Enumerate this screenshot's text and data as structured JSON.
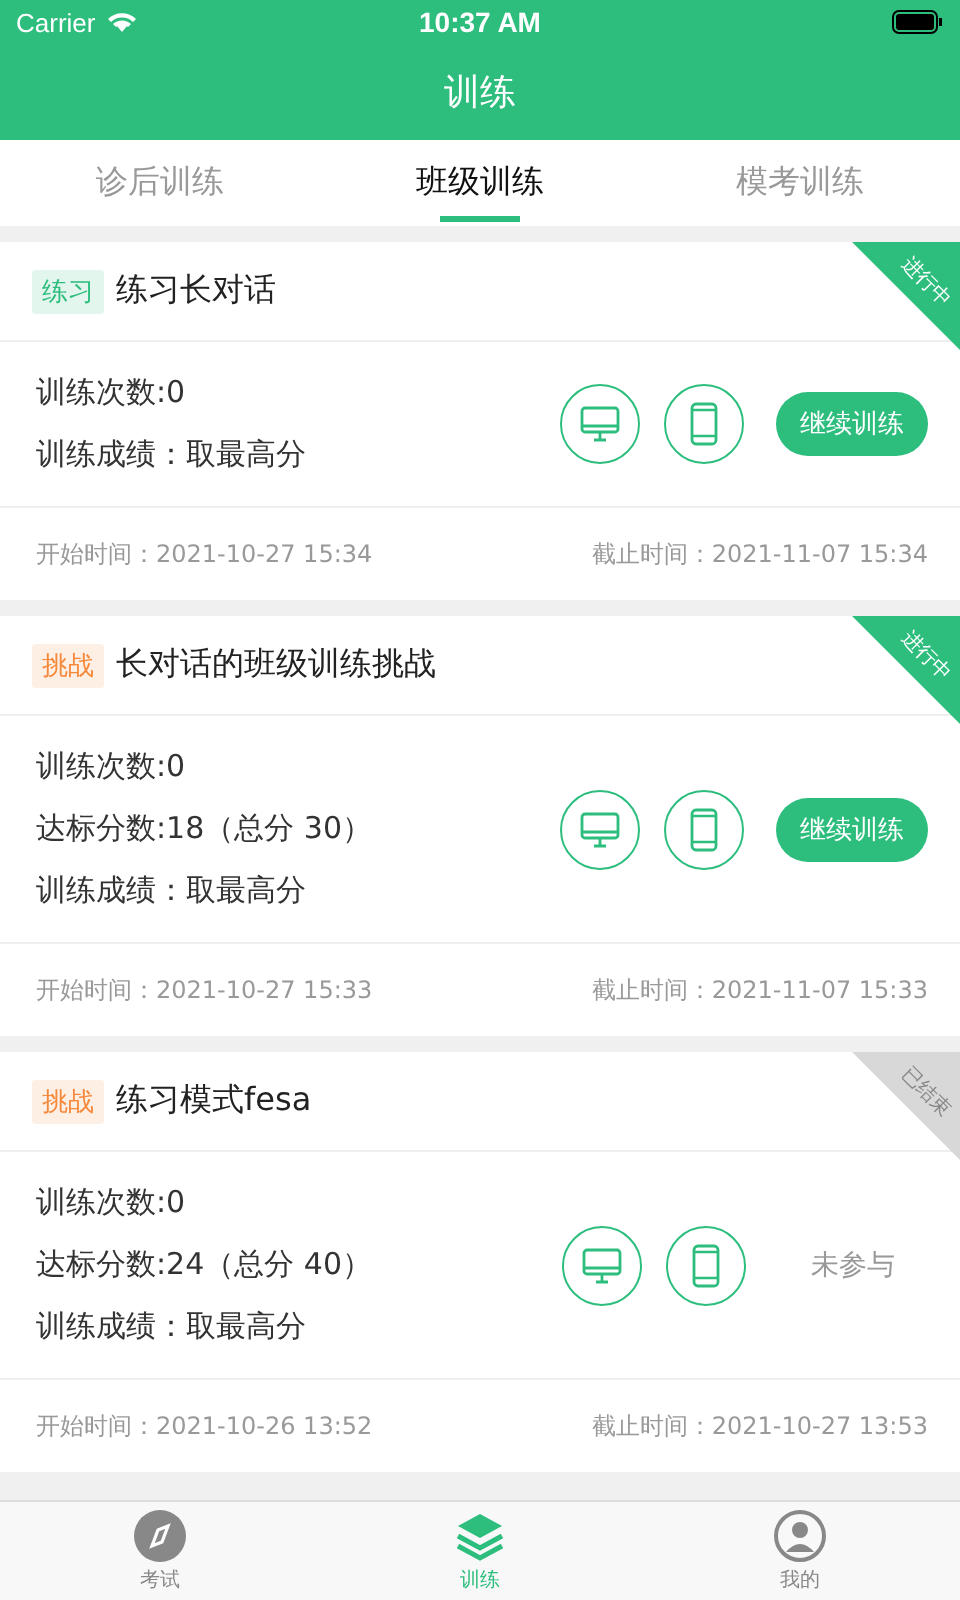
{
  "status_bar": {
    "carrier": "Carrier",
    "time": "10:37 AM"
  },
  "nav": {
    "title": "训练"
  },
  "tabs": [
    {
      "label": "诊后训练",
      "selected": false
    },
    {
      "label": "班级训练",
      "selected": true
    },
    {
      "label": "模考训练",
      "selected": false
    }
  ],
  "cards": [
    {
      "tag": {
        "label": "练习",
        "color": "#2dbe7e"
      },
      "title": "练习长对话",
      "ribbon": {
        "label": "进行中",
        "kind": "active"
      },
      "lines": [
        "训练次数:0",
        "训练成绩：取最高分"
      ],
      "action": {
        "kind": "button",
        "label": "继续训练"
      },
      "start": "开始时间：2021-10-27 15:34",
      "end": "截止时间：2021-11-07 15:34"
    },
    {
      "tag": {
        "label": "挑战",
        "color": "#f5883a"
      },
      "title": "长对话的班级训练挑战",
      "ribbon": {
        "label": "进行中",
        "kind": "active"
      },
      "lines": [
        "训练次数:0",
        "达标分数:18（总分 30）",
        "训练成绩：取最高分"
      ],
      "action": {
        "kind": "button",
        "label": "继续训练"
      },
      "start": "开始时间：2021-10-27 15:33",
      "end": "截止时间：2021-11-07 15:33"
    },
    {
      "tag": {
        "label": "挑战",
        "color": "#f5883a"
      },
      "title": "练习模式fesa",
      "ribbon": {
        "label": "已结束",
        "kind": "ended"
      },
      "lines": [
        "训练次数:0",
        "达标分数:24（总分 40）",
        "训练成绩：取最高分"
      ],
      "action": {
        "kind": "text",
        "label": "未参与"
      },
      "start": "开始时间：2021-10-26 13:52",
      "end": "截止时间：2021-10-27 13:53"
    }
  ],
  "bottom_tabs": [
    {
      "label": "考试",
      "kind": "compass",
      "selected": false
    },
    {
      "label": "训练",
      "kind": "layers",
      "selected": true
    },
    {
      "label": "我的",
      "kind": "person",
      "selected": false
    }
  ]
}
